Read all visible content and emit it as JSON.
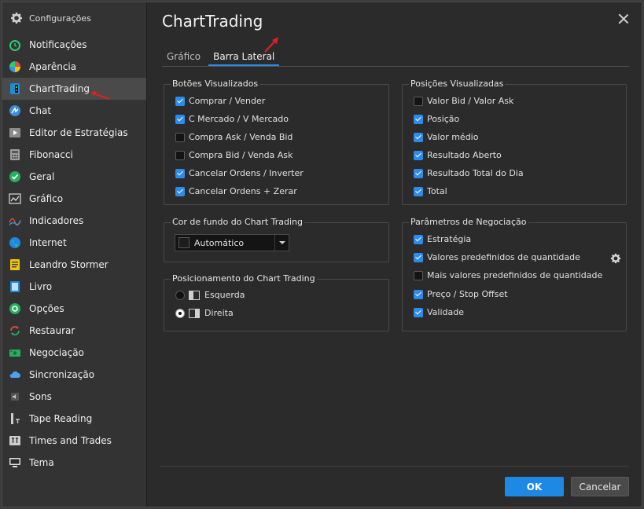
{
  "sidebar": {
    "header": "Configurações",
    "items": [
      {
        "label": "Notificações",
        "icon": "alarm-clock-icon"
      },
      {
        "label": "Aparência",
        "icon": "color-wheel-icon"
      },
      {
        "label": "ChartTrading",
        "icon": "chart-trading-icon"
      },
      {
        "label": "Chat",
        "icon": "chat-icon"
      },
      {
        "label": "Editor de Estratégias",
        "icon": "play-editor-icon"
      },
      {
        "label": "Fibonacci",
        "icon": "calculator-icon"
      },
      {
        "label": "Geral",
        "icon": "check-circle-icon"
      },
      {
        "label": "Gráfico",
        "icon": "line-chart-icon"
      },
      {
        "label": "Indicadores",
        "icon": "indicators-icon"
      },
      {
        "label": "Internet",
        "icon": "globe-icon"
      },
      {
        "label": "Leandro Stormer",
        "icon": "book-icon"
      },
      {
        "label": "Livro",
        "icon": "ledger-icon"
      },
      {
        "label": "Opções",
        "icon": "options-icon"
      },
      {
        "label": "Restaurar",
        "icon": "restore-icon"
      },
      {
        "label": "Negociação",
        "icon": "money-icon"
      },
      {
        "label": "Sincronização",
        "icon": "cloud-icon"
      },
      {
        "label": "Sons",
        "icon": "sound-icon"
      },
      {
        "label": "Tape Reading",
        "icon": "tape-reading-icon"
      },
      {
        "label": "Times and Trades",
        "icon": "times-trades-icon"
      },
      {
        "label": "Tema",
        "icon": "monitor-icon"
      }
    ]
  },
  "main": {
    "title": "ChartTrading",
    "tabs": [
      {
        "label": "Gráfico"
      },
      {
        "label": "Barra Lateral"
      }
    ],
    "botoes": {
      "title": "Botões Visualizados",
      "items": [
        {
          "label": "Comprar / Vender",
          "checked": true
        },
        {
          "label": "C Mercado / V Mercado",
          "checked": true
        },
        {
          "label": "Compra Ask /  Venda Bid",
          "checked": false
        },
        {
          "label": "Compra Bid / Venda Ask",
          "checked": false
        },
        {
          "label": "Cancelar Ordens / Inverter",
          "checked": true
        },
        {
          "label": "Cancelar Ordens + Zerar",
          "checked": true
        }
      ]
    },
    "posicoes": {
      "title": "Posições Visualizadas",
      "items": [
        {
          "label": "Valor Bid / Valor Ask",
          "checked": false
        },
        {
          "label": "Posição",
          "checked": true
        },
        {
          "label": "Valor médio",
          "checked": true
        },
        {
          "label": "Resultado Aberto",
          "checked": true
        },
        {
          "label": "Resultado Total do Dia",
          "checked": true
        },
        {
          "label": "Total",
          "checked": true
        }
      ]
    },
    "cor_fundo": {
      "title": "Cor de fundo do Chart Trading",
      "value": "Automático"
    },
    "posicionamento": {
      "title": "Posicionamento do Chart Trading",
      "options": [
        {
          "label": "Esquerda",
          "selected": false
        },
        {
          "label": "Direita",
          "selected": true
        }
      ]
    },
    "parametros": {
      "title": "Parâmetros de Negociação",
      "items": [
        {
          "label": "Estratégia",
          "checked": true
        },
        {
          "label": "Valores predefinidos de quantidade",
          "checked": true
        },
        {
          "label": "Mais valores predefinidos de quantidade",
          "checked": false
        },
        {
          "label": "Preço / Stop Offset",
          "checked": true
        },
        {
          "label": "Validade",
          "checked": true
        }
      ]
    }
  },
  "footer": {
    "ok_label": "OK",
    "cancel_label": "Cancelar"
  },
  "colors": {
    "accent": "#1e88e5",
    "annotation_arrow": "#e02020"
  }
}
